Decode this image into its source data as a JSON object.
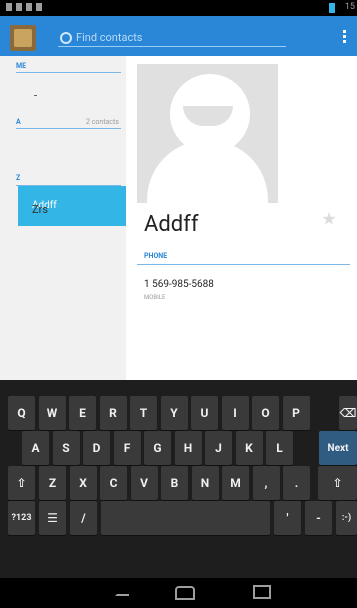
{
  "status": {
    "time": "15"
  },
  "search": {
    "placeholder": "Find contacts"
  },
  "list": {
    "header_me": "ME",
    "count": "2 contacts",
    "me_item": "-",
    "header_a": "A",
    "selected": "Addff",
    "header_z": "Z",
    "item_z": "Zrs"
  },
  "detail": {
    "name": "Addff",
    "phone_header": "PHONE",
    "phone": "1 569-985-5688",
    "phone_type": "MOBILE"
  },
  "keyboard": {
    "row1": [
      "Q",
      "W",
      "E",
      "R",
      "T",
      "Y",
      "U",
      "I",
      "O",
      "P"
    ],
    "row2": [
      "A",
      "S",
      "D",
      "F",
      "G",
      "H",
      "J",
      "K",
      "L"
    ],
    "next": "Next",
    "row3": [
      "Z",
      "X",
      "C",
      "V",
      "B",
      "N",
      "M",
      ",",
      "."
    ],
    "sym": "?123",
    "slash": "/",
    "apostrophe": "'",
    "dash": "-",
    "smiley": ":-)"
  }
}
